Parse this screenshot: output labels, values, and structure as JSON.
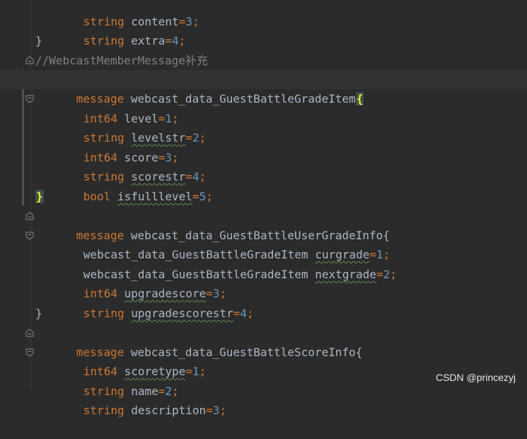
{
  "lines": [
    {
      "t1": "string",
      "t2": " content",
      "t3": "=",
      "t4": "3",
      "t5": ";"
    },
    {
      "t1": "string",
      "t2": " extra",
      "t3": "=",
      "t4": "4",
      "t5": ";"
    },
    {
      "brace": "}"
    },
    {
      "comment": "//WebcastMemberMessage补充"
    },
    {
      "kw": "message",
      "name": " webcast_data_GuestBattleGradeItem",
      "brace": "{"
    },
    {
      "t1": "int64",
      "t2": " level",
      "t3": "=",
      "t4": "1",
      "t5": ";"
    },
    {
      "t1": "string",
      "t2a": " ",
      "t2": "levelstr",
      "t3": "=",
      "t4": "2",
      "t5": ";"
    },
    {
      "t1": "int64",
      "t2": " score",
      "t3": "=",
      "t4": "3",
      "t5": ";"
    },
    {
      "t1": "string",
      "t2a": " ",
      "t2": "scorestr",
      "t3": "=",
      "t4": "4",
      "t5": ";"
    },
    {
      "t1": "bool",
      "t2a": " ",
      "t2": "isfulllevel",
      "t3": "=",
      "t4": "5",
      "t5": ";"
    },
    {
      "brace": "}"
    },
    {
      "kw": "message",
      "name": " webcast_data_GuestBattleUserGradeInfo",
      "brace": "{"
    },
    {
      "t1": "webcast_data_GuestBattleGradeItem",
      "t2a": " ",
      "t2": "curgrade",
      "t3": "=",
      "t4": "1",
      "t5": ";"
    },
    {
      "t1": "webcast_data_GuestBattleGradeItem",
      "t2a": " ",
      "t2": "nextgrade",
      "t3": "=",
      "t4": "2",
      "t5": ";"
    },
    {
      "t1": "int64",
      "t2a": " ",
      "t2": "upgradescore",
      "t3": "=",
      "t4": "3",
      "t5": ";"
    },
    {
      "t1": "string",
      "t2a": " ",
      "t2": "upgradescorestr",
      "t3": "=",
      "t4": "4",
      "t5": ";"
    },
    {
      "brace": "}"
    },
    {
      "kw": "message",
      "name": " webcast_data_GuestBattleScoreInfo",
      "brace": "{"
    },
    {
      "t1": "int64",
      "t2a": " ",
      "t2": "scoretype",
      "t3": "=",
      "t4": "1",
      "t5": ";"
    },
    {
      "t1": "string",
      "t2": " name",
      "t3": "=",
      "t4": "2",
      "t5": ";"
    },
    {
      "t1": "string",
      "t2": " description",
      "t3": "=",
      "t4": "3",
      "t5": ";"
    }
  ],
  "watermark": "CSDN @princezyj",
  "colors": {
    "background": "#2b2b2b",
    "keyword": "#cc7832",
    "identifier": "#a9b7c6",
    "number": "#6897bb",
    "comment": "#808080",
    "brace_match": "#ffef28"
  }
}
